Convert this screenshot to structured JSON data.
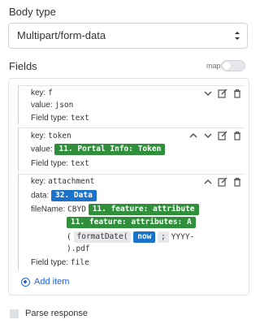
{
  "body_type": {
    "label": "Body type",
    "selected": "Multipart/form-data"
  },
  "fields": {
    "label": "Fields",
    "map_label": "map:",
    "items": [
      {
        "key_label": "key:",
        "key_value": "f",
        "value_label": "value:",
        "value_text": "json",
        "type_label": "Field type:",
        "type_value": "text"
      },
      {
        "key_label": "key:",
        "key_value": "token",
        "value_label": "value:",
        "value_pill": "11. Portal Info: Token",
        "type_label": "Field type:",
        "type_value": "text"
      },
      {
        "key_label": "key:",
        "key_value": "attachment",
        "data_label": "data:",
        "data_pill": "32. Data",
        "filename_label": "fileName:",
        "filename_prefix": "CBYD",
        "filename_pill_1": "11. feature: attribute",
        "filename_pill_2": "11. feature: attributes: A",
        "func_open": "(",
        "func_name": "formatDate(",
        "func_arg_pill": "now",
        "func_sep": ";",
        "func_format": "YYYY-",
        "func_close": ").pdf",
        "type_label": "Field type:",
        "type_value": "file"
      }
    ],
    "add_item_label": "Add item"
  },
  "parse_response": {
    "label": "Parse response"
  },
  "colors": {
    "green_pill": "#2f8f3a",
    "blue_pill": "#1a73c9",
    "link": "#2563eb"
  }
}
